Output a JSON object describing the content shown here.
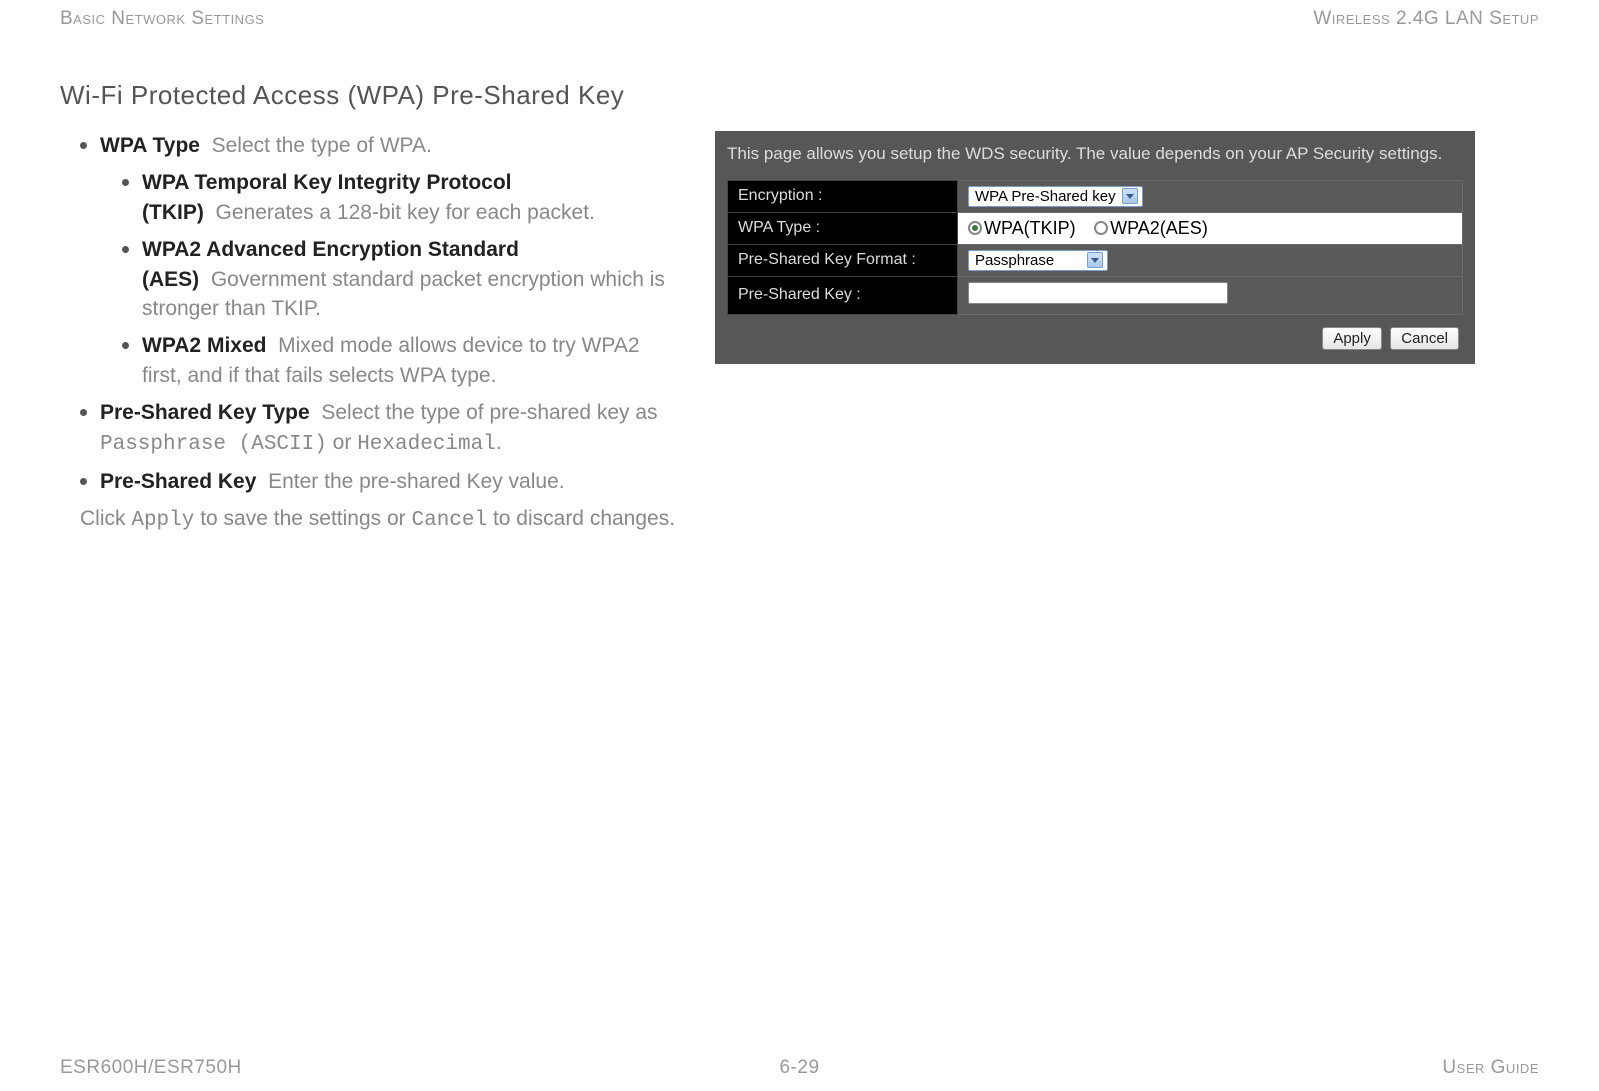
{
  "header": {
    "left": "Basic Network Settings",
    "right": "Wireless 2.4G LAN Setup"
  },
  "section_title": "Wi-Fi Protected Access (WPA) Pre-Shared Key",
  "items": {
    "wpa_type": {
      "term": "WPA Type",
      "desc": "Select the type of WPA."
    },
    "tkip": {
      "term": "WPA Temporal Key Integrity Protocol (TKIP)",
      "desc": "Generates a 128-bit key for each packet."
    },
    "aes": {
      "term": "WPA2 Advanced Encryption Standard (AES)",
      "desc": "Government standard packet encryption which is stronger than TKIP."
    },
    "mixed": {
      "term": "WPA2 Mixed",
      "desc": "Mixed mode allows device to try WPA2 first, and if that fails selects WPA type."
    },
    "psk_type": {
      "term": "Pre-Shared Key Type",
      "desc_pre": "Select the type of pre-shared key as ",
      "opt1": "Passphrase (ASCII)",
      "mid": " or ",
      "opt2": "Hexadecimal",
      "suffix": "."
    },
    "psk": {
      "term": "Pre-Shared Key",
      "desc": "Enter the pre-shared Key value."
    }
  },
  "after_list": {
    "pre": "Click ",
    "apply": "Apply",
    "mid": " to save the settings or ",
    "cancel": "Cancel",
    "post": " to discard changes."
  },
  "panel": {
    "intro": "This page allows you setup the WDS security. The value depends on your AP Security settings.",
    "rows": {
      "encryption_label": "Encryption :",
      "encryption_value": "WPA Pre-Shared key",
      "wpa_type_label": "WPA Type :",
      "wpa_opt1": "WPA(TKIP)",
      "wpa_opt2": "WPA2(AES)",
      "psk_format_label": "Pre-Shared Key Format :",
      "psk_format_value": "Passphrase",
      "psk_label": "Pre-Shared Key :"
    },
    "buttons": {
      "apply": "Apply",
      "cancel": "Cancel"
    }
  },
  "footer": {
    "left": "ESR600H/ESR750H",
    "center": "6-29",
    "right": "User Guide"
  }
}
